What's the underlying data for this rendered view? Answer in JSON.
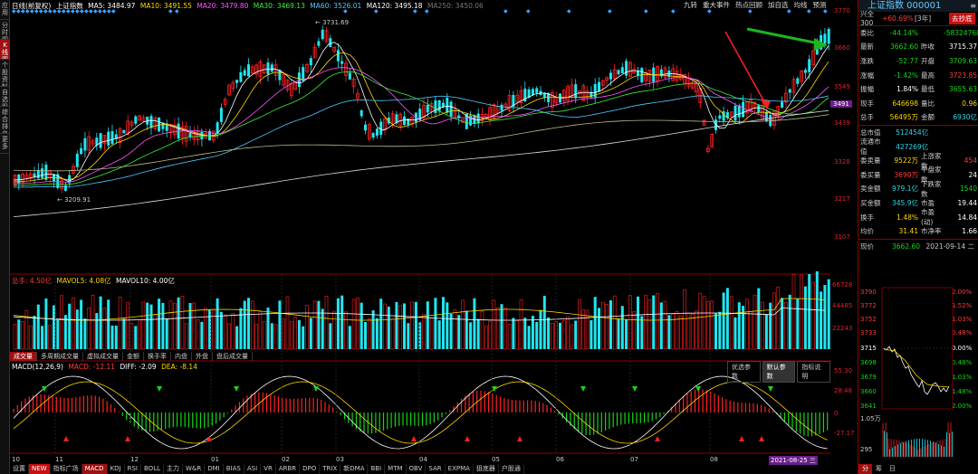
{
  "left_toolbar": {
    "items": [
      {
        "label": "应用",
        "active": false
      },
      {
        "label": "分时图",
        "active": false
      },
      {
        "label": "K线图",
        "active": true
      },
      {
        "label": "个股资料",
        "active": false
      },
      {
        "label": "自选股",
        "active": false
      },
      {
        "label": "综合排名",
        "active": false
      },
      {
        "label": "更多",
        "active": false
      }
    ]
  },
  "kline_legend": {
    "period": "日线(前复权)",
    "name": "上证指数",
    "ma5": "MA5: 3484.97",
    "ma10": "MA10: 3491.55",
    "ma20": "MA20: 3479.80",
    "ma30": "MA30: 3469.13",
    "ma60": "MA60: 3526.01",
    "ma120": "MA120: 3495.18",
    "ma250": "MA250: 3450.06"
  },
  "top_toolbar": [
    "九转",
    "重大事件",
    "热点回顾",
    "加自选",
    "均线",
    "预测"
  ],
  "price_axis": {
    "labels": [
      "3770",
      "3660",
      "3549",
      "3439",
      "3328",
      "3217",
      "3107"
    ],
    "marker": "3491"
  },
  "annotations": {
    "high": "3731.69",
    "low": "3209.91"
  },
  "volume_legend": {
    "total": "总手: 4.50亿",
    "mavol5": "MAVOL5: 4.08亿",
    "mavol10": "MAVOL10: 4.00亿"
  },
  "volume_axis": [
    "66728",
    "44485",
    "22243"
  ],
  "volume_tabs": [
    {
      "label": "成交量",
      "active": true
    },
    {
      "label": "多周期成交量",
      "active": false
    },
    {
      "label": "虚拟成交量",
      "active": false
    },
    {
      "label": "金额",
      "active": false
    },
    {
      "label": "换手率",
      "active": false
    },
    {
      "label": "内盘",
      "active": false
    },
    {
      "label": "外盘",
      "active": false
    },
    {
      "label": "盘后成交量",
      "active": false
    }
  ],
  "macd_legend": {
    "params": "MACD(12,26,9)",
    "macd": "MACD: -12.11",
    "diff": "DIFF: -2.09",
    "dea": "DEA: -8.14"
  },
  "macd_buttons": [
    "优选参数",
    "默认参数",
    "指标说明"
  ],
  "macd_axis": [
    "55.30",
    "28.48",
    "0",
    "-27.17"
  ],
  "x_axis": {
    "labels": [
      "10",
      "11",
      "12",
      "01",
      "02",
      "03",
      "04",
      "05",
      "06",
      "07",
      "08"
    ],
    "cursor_date": "2021-08-25 三"
  },
  "bottom_indicators": [
    {
      "label": "设置",
      "active": false
    },
    {
      "label": "NEW",
      "active": false
    },
    {
      "label": "指标广场",
      "active": false
    },
    {
      "label": "MACD",
      "active": true
    },
    {
      "label": "KDJ",
      "active": false
    },
    {
      "label": "RSI",
      "active": false
    },
    {
      "label": "BOLL",
      "active": false
    },
    {
      "label": "主力",
      "active": false
    },
    {
      "label": "W&R",
      "active": false
    },
    {
      "label": "DMI",
      "active": false
    },
    {
      "label": "BIAS",
      "active": false
    },
    {
      "label": "ASI",
      "active": false
    },
    {
      "label": "VR",
      "active": false
    },
    {
      "label": "ARBR",
      "active": false
    },
    {
      "label": "DPO",
      "active": false
    },
    {
      "label": "TRIX",
      "active": false
    },
    {
      "label": "新DMA",
      "active": false
    },
    {
      "label": "BBI",
      "active": false
    },
    {
      "label": "MTM",
      "active": false
    },
    {
      "label": "OBV",
      "active": false
    },
    {
      "label": "SAR",
      "active": false
    },
    {
      "label": "EXPMA",
      "active": false
    },
    {
      "label": "狙底器",
      "active": false
    },
    {
      "label": "户股通",
      "active": false
    }
  ],
  "right_panel": {
    "title": "上证指数 000001",
    "related": "兴全300",
    "related_change": "+60.69%",
    "related_period": "[3年]",
    "related_button": "去抄底",
    "quote_rows": [
      {
        "k1": "委比",
        "v1": "-44.14%",
        "c1": "green",
        "k2": "",
        "v2": "-58324760",
        "c2": "green"
      },
      {
        "k1": "最新",
        "v1": "3662.60",
        "c1": "green",
        "k2": "昨收",
        "v2": "3715.37",
        "c2": "white"
      },
      {
        "k1": "涨跌",
        "v1": "-52.77",
        "c1": "green",
        "k2": "开盘",
        "v2": "3709.63",
        "c2": "green"
      },
      {
        "k1": "涨幅",
        "v1": "-1.42%",
        "c1": "green",
        "k2": "最高",
        "v2": "3723.85",
        "c2": "red"
      },
      {
        "k1": "振幅",
        "v1": "1.84%",
        "c1": "white",
        "k2": "最低",
        "v2": "3655.63",
        "c2": "green"
      },
      {
        "k1": "现手",
        "v1": "646698",
        "c1": "yellow",
        "k2": "量比",
        "v2": "0.96",
        "c2": "yellow"
      },
      {
        "k1": "总手",
        "v1": "56495万",
        "c1": "yellow",
        "k2": "金额",
        "v2": "6930亿",
        "c2": "cyan"
      }
    ],
    "market_rows": [
      {
        "k1": "总市值",
        "v1": "512454亿",
        "c1": "cyan",
        "k2": "",
        "v2": "",
        "c2": "white"
      },
      {
        "k1": "流通市值",
        "v1": "427269亿",
        "c1": "cyan",
        "k2": "",
        "v2": "",
        "c2": "white"
      },
      {
        "k1": "委卖量",
        "v1": "9522万",
        "c1": "yellow",
        "k2": "上涨家数",
        "v2": "454",
        "c2": "red"
      },
      {
        "k1": "委买量",
        "v1": "3690万",
        "c1": "red",
        "k2": "平盘家数",
        "v2": "24",
        "c2": "white"
      },
      {
        "k1": "卖金额",
        "v1": "979.1亿",
        "c1": "cyan",
        "k2": "下跌家数",
        "v2": "1540",
        "c2": "green"
      },
      {
        "k1": "买金额",
        "v1": "345.9亿",
        "c1": "cyan",
        "k2": "市盈",
        "v2": "19.44",
        "c2": "white"
      },
      {
        "k1": "换手",
        "v1": "1.48%",
        "c1": "yellow",
        "k2": "市盈(动)",
        "v2": "14.84",
        "c2": "white"
      },
      {
        "k1": "均价",
        "v1": "31.41",
        "c1": "yellow",
        "k2": "市净率",
        "v2": "1.66",
        "c2": "white"
      }
    ],
    "now_label": "现价",
    "now_value": "3662.60",
    "now_date": "2021-09-14 二",
    "intraday_axis_left": [
      "3790",
      "3772",
      "3752",
      "3733",
      "3715",
      "3698",
      "3679",
      "3660",
      "3641"
    ],
    "intraday_axis_right": [
      "2.00%",
      "1.52%",
      "1.03%",
      "0.48%",
      "0.00%",
      "0.48%",
      "1.03%",
      "1.48%",
      "2.00%"
    ],
    "volume_axis": [
      "1.05万",
      "295"
    ],
    "bottom_tabs": [
      "分",
      "筹",
      "日"
    ]
  }
}
